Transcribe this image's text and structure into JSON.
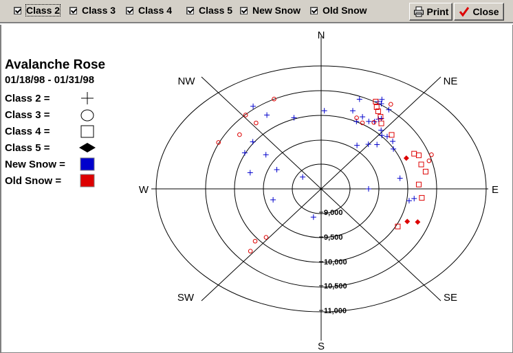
{
  "toolbar": {
    "checkboxes": [
      {
        "label": "Class 2",
        "checked": true
      },
      {
        "label": "Class 3",
        "checked": true
      },
      {
        "label": "Class 4",
        "checked": true
      },
      {
        "label": "Class 5",
        "checked": true
      },
      {
        "label": "New Snow",
        "checked": true
      },
      {
        "label": "Old Snow",
        "checked": true
      }
    ],
    "print_label": "Print",
    "close_label": "Close"
  },
  "legend": {
    "title": "Avalanche Rose",
    "date_range": "01/18/98 - 01/31/98",
    "items": [
      {
        "label": "Class 2 =",
        "symbol": "plus-icon"
      },
      {
        "label": "Class 3 =",
        "symbol": "circle-icon"
      },
      {
        "label": "Class 4 =",
        "symbol": "square-icon"
      },
      {
        "label": "Class 5 =",
        "symbol": "diamond-icon"
      },
      {
        "label": "New Snow =",
        "symbol": "blue-swatch"
      },
      {
        "label": "Old Snow =",
        "symbol": "red-swatch"
      }
    ]
  },
  "colors": {
    "new_snow": "#0000cc",
    "old_snow": "#dd0000",
    "toolbar_bg": "#d4d0c8"
  },
  "chart_data": {
    "type": "scatter",
    "projection": "polar",
    "directions": [
      "N",
      "NE",
      "E",
      "SE",
      "S",
      "SW",
      "W",
      "NW"
    ],
    "elevation_ticks": [
      "9,000",
      "9,500",
      "10,000",
      "10,500",
      "11,000"
    ],
    "points": [
      {
        "aspect_deg": 36,
        "elevation": 10270,
        "class": 2,
        "snow": "new"
      },
      {
        "aspect_deg": 35,
        "elevation": 10230,
        "class": 2,
        "snow": "new"
      },
      {
        "aspect_deg": 34,
        "elevation": 10150,
        "class": 2,
        "snow": "new"
      },
      {
        "aspect_deg": 31,
        "elevation": 10100,
        "class": 2,
        "snow": "new"
      },
      {
        "aspect_deg": 26,
        "elevation": 10130,
        "class": 2,
        "snow": "new"
      },
      {
        "aspect_deg": 19,
        "elevation": 10180,
        "class": 2,
        "snow": "new"
      },
      {
        "aspect_deg": 24,
        "elevation": 10000,
        "class": 2,
        "snow": "new"
      },
      {
        "aspect_deg": 41,
        "elevation": 10080,
        "class": 2,
        "snow": "new"
      },
      {
        "aspect_deg": 44,
        "elevation": 10010,
        "class": 2,
        "snow": "new"
      },
      {
        "aspect_deg": 47,
        "elevation": 10060,
        "class": 2,
        "snow": "new"
      },
      {
        "aspect_deg": 52,
        "elevation": 10070,
        "class": 2,
        "snow": "new"
      },
      {
        "aspect_deg": 57,
        "elevation": 9990,
        "class": 2,
        "snow": "new"
      },
      {
        "aspect_deg": 47,
        "elevation": 9820,
        "class": 2,
        "snow": "new"
      },
      {
        "aspect_deg": 42,
        "elevation": 9720,
        "class": 2,
        "snow": "new"
      },
      {
        "aspect_deg": 35,
        "elevation": 9580,
        "class": 2,
        "snow": "new"
      },
      {
        "aspect_deg": 2,
        "elevation": 10090,
        "class": 2,
        "snow": "new"
      },
      {
        "aspect_deg": 20,
        "elevation": 10440,
        "class": 2,
        "snow": "new"
      },
      {
        "aspect_deg": 31,
        "elevation": 10520,
        "class": 2,
        "snow": "new"
      },
      {
        "aspect_deg": 36,
        "elevation": 10490,
        "class": 2,
        "snow": "new"
      },
      {
        "aspect_deg": 29,
        "elevation": 10530,
        "class": 2,
        "snow": "new"
      },
      {
        "aspect_deg": 30,
        "elevation": 10600,
        "class": 2,
        "snow": "new"
      },
      {
        "aspect_deg": 81,
        "elevation": 9880,
        "class": 2,
        "snow": "new"
      },
      {
        "aspect_deg": 90,
        "elevation": 9320,
        "class": 2,
        "snow": "new"
      },
      {
        "aspect_deg": 99,
        "elevation": 10040,
        "class": 2,
        "snow": "new"
      },
      {
        "aspect_deg": 97,
        "elevation": 10120,
        "class": 2,
        "snow": "new"
      },
      {
        "aspect_deg": 325,
        "elevation": 10550,
        "class": 2,
        "snow": "new"
      },
      {
        "aspect_deg": 328,
        "elevation": 10270,
        "class": 2,
        "snow": "new"
      },
      {
        "aspect_deg": 342,
        "elevation": 10020,
        "class": 2,
        "snow": "new"
      },
      {
        "aspect_deg": 309,
        "elevation": 10020,
        "class": 2,
        "snow": "new"
      },
      {
        "aspect_deg": 306,
        "elevation": 9680,
        "class": 2,
        "snow": "new"
      },
      {
        "aspect_deg": 299,
        "elevation": 10010,
        "class": 2,
        "snow": "new"
      },
      {
        "aspect_deg": 285,
        "elevation": 9770,
        "class": 2,
        "snow": "new"
      },
      {
        "aspect_deg": 297,
        "elevation": 9360,
        "class": 2,
        "snow": "new"
      },
      {
        "aspect_deg": 255,
        "elevation": 9360,
        "class": 2,
        "snow": "new"
      },
      {
        "aspect_deg": 307,
        "elevation": 8900,
        "class": 2,
        "snow": "new"
      },
      {
        "aspect_deg": 193,
        "elevation": 9090,
        "class": 2,
        "snow": "new"
      },
      {
        "aspect_deg": 319,
        "elevation": 10490,
        "class": 3,
        "snow": "old"
      },
      {
        "aspect_deg": 336,
        "elevation": 10500,
        "class": 3,
        "snow": "old"
      },
      {
        "aspect_deg": 308,
        "elevation": 10290,
        "class": 3,
        "snow": "old"
      },
      {
        "aspect_deg": 298,
        "elevation": 10510,
        "class": 3,
        "snow": "old"
      },
      {
        "aspect_deg": 320,
        "elevation": 10250,
        "class": 3,
        "snow": "old"
      },
      {
        "aspect_deg": 23,
        "elevation": 10070,
        "class": 3,
        "snow": "old"
      },
      {
        "aspect_deg": 28,
        "elevation": 10020,
        "class": 3,
        "snow": "old"
      },
      {
        "aspect_deg": 35,
        "elevation": 10600,
        "class": 3,
        "snow": "old"
      },
      {
        "aspect_deg": 34,
        "elevation": 10130,
        "class": 3,
        "snow": "old"
      },
      {
        "aspect_deg": 70,
        "elevation": 10530,
        "class": 3,
        "snow": "old"
      },
      {
        "aspect_deg": 73,
        "elevation": 10450,
        "class": 3,
        "snow": "old"
      },
      {
        "aspect_deg": 224,
        "elevation": 9870,
        "class": 3,
        "snow": "old"
      },
      {
        "aspect_deg": 227,
        "elevation": 10060,
        "class": 3,
        "snow": "old"
      },
      {
        "aspect_deg": 224,
        "elevation": 10260,
        "class": 3,
        "snow": "old"
      },
      {
        "aspect_deg": 28,
        "elevation": 10510,
        "class": 4,
        "snow": "old"
      },
      {
        "aspect_deg": 30,
        "elevation": 10420,
        "class": 4,
        "snow": "old"
      },
      {
        "aspect_deg": 32,
        "elevation": 10360,
        "class": 4,
        "snow": "old"
      },
      {
        "aspect_deg": 35,
        "elevation": 10290,
        "class": 4,
        "snow": "old"
      },
      {
        "aspect_deg": 38,
        "elevation": 10190,
        "class": 4,
        "snow": "old"
      },
      {
        "aspect_deg": 48,
        "elevation": 10140,
        "class": 4,
        "snow": "old"
      },
      {
        "aspect_deg": 66,
        "elevation": 10260,
        "class": 4,
        "snow": "old"
      },
      {
        "aspect_deg": 68,
        "elevation": 10320,
        "class": 4,
        "snow": "old"
      },
      {
        "aspect_deg": 74,
        "elevation": 10300,
        "class": 4,
        "snow": "old"
      },
      {
        "aspect_deg": 79,
        "elevation": 10340,
        "class": 4,
        "snow": "old"
      },
      {
        "aspect_deg": 87,
        "elevation": 10190,
        "class": 4,
        "snow": "old"
      },
      {
        "aspect_deg": 96,
        "elevation": 10250,
        "class": 4,
        "snow": "old"
      },
      {
        "aspect_deg": 120,
        "elevation": 10030,
        "class": 4,
        "snow": "old"
      },
      {
        "aspect_deg": 67,
        "elevation": 10100,
        "class": 5,
        "snow": "old"
      },
      {
        "aspect_deg": 112,
        "elevation": 10300,
        "class": 5,
        "snow": "old"
      },
      {
        "aspect_deg": 114,
        "elevation": 10130,
        "class": 5,
        "snow": "old"
      }
    ]
  }
}
